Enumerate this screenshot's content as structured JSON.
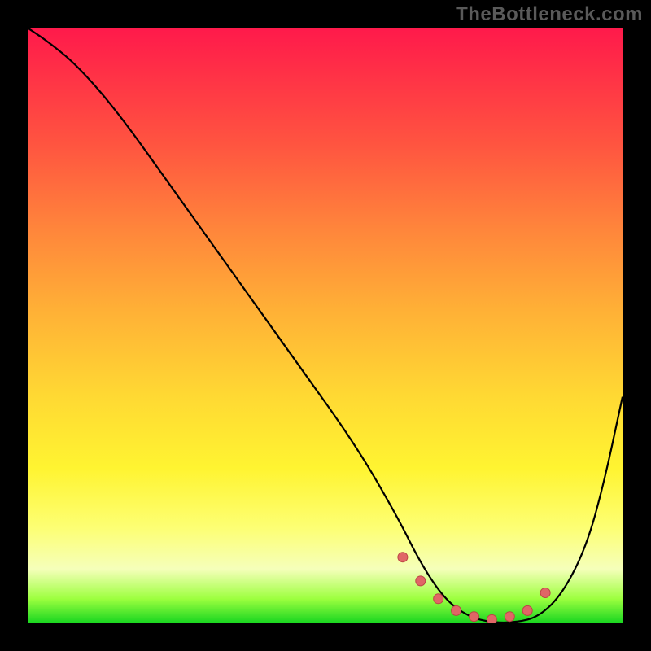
{
  "watermark": "TheBottleneck.com",
  "colors": {
    "background": "#000000",
    "curve": "#000000",
    "markers_fill": "#e06666",
    "markers_stroke": "#bb4545",
    "gradient_top": "#ff1a4b",
    "gradient_bottom": "#1bd721"
  },
  "chart_data": {
    "type": "line",
    "title": "",
    "xlabel": "",
    "ylabel": "",
    "xlim": [
      0,
      100
    ],
    "ylim": [
      0,
      100
    ],
    "grid": false,
    "legend": false,
    "series": [
      {
        "name": "bottleneck-curve",
        "x": [
          0,
          3,
          8,
          15,
          25,
          35,
          45,
          55,
          62,
          66,
          70,
          74,
          78,
          82,
          86,
          90,
          94,
          97,
          100
        ],
        "values": [
          100,
          98,
          94,
          86,
          72,
          58,
          44,
          30,
          18,
          10,
          4,
          1,
          0,
          0,
          1,
          5,
          13,
          24,
          38
        ]
      }
    ],
    "markers": {
      "name": "highlighted-range",
      "x": [
        63,
        66,
        69,
        72,
        75,
        78,
        81,
        84,
        87
      ],
      "values": [
        11,
        7,
        4,
        2,
        1,
        0.5,
        1,
        2,
        5
      ]
    }
  }
}
